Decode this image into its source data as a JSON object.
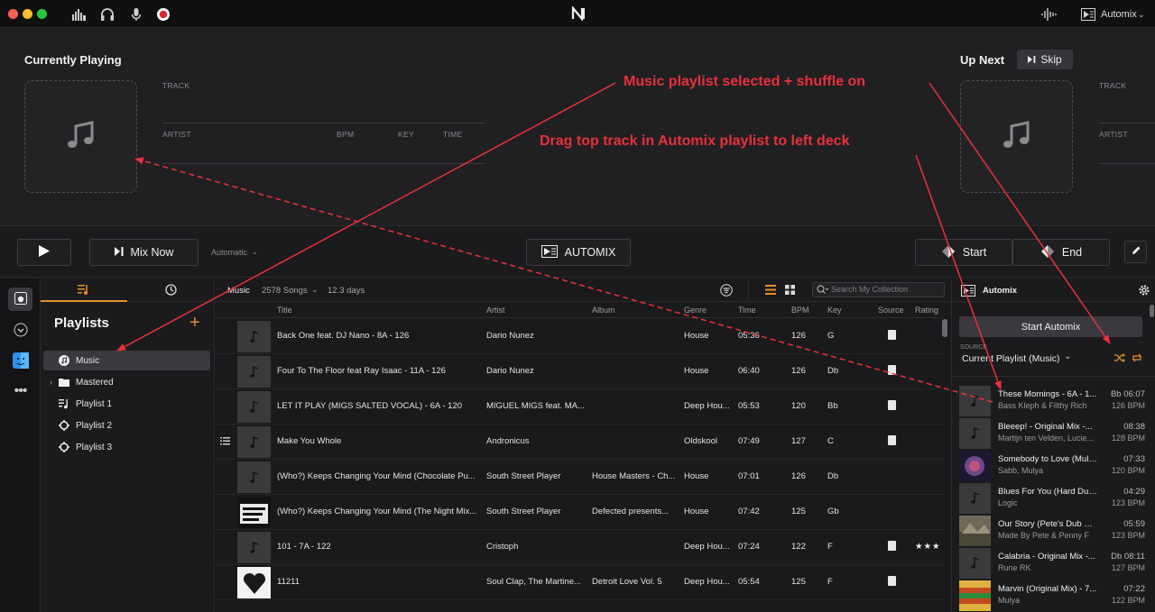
{
  "titlebar": {
    "automix_label": "Automix",
    "colors": {
      "close": "#fe5f57",
      "min": "#febc2e",
      "max": "#28c840"
    }
  },
  "left_deck": {
    "title": "Currently Playing",
    "track_label": "TRACK",
    "artist_label": "ARTIST",
    "bpm_label": "BPM",
    "key_label": "KEY",
    "time_label": "TIME"
  },
  "right_deck": {
    "title": "Up Next",
    "skip_label": "Skip",
    "track_label": "TRACK",
    "artist_label": "ARTIST"
  },
  "transport": {
    "mix_now_label": "Mix Now",
    "mode_label": "Automatic",
    "automix_label": "AUTOMIX",
    "start_label": "Start",
    "end_label": "End"
  },
  "playlists": {
    "title": "Playlists",
    "add_label": "+",
    "items": [
      {
        "label": "Music",
        "selected": true,
        "icon": "music-circle-icon"
      },
      {
        "label": "Mastered",
        "icon": "folder-icon"
      },
      {
        "label": "Playlist 1",
        "icon": "playlist-icon"
      },
      {
        "label": "Playlist 2",
        "icon": "smart-playlist-icon"
      },
      {
        "label": "Playlist 3",
        "icon": "smart-playlist-icon"
      }
    ]
  },
  "collection": {
    "source_label": "Music",
    "song_count": "2578 Songs",
    "duration": "12.3 days",
    "search_placeholder": "Search My Collection",
    "columns": [
      "Title",
      "Artist",
      "Album",
      "Genre",
      "Time",
      "BPM",
      "Key",
      "Source",
      "Rating"
    ],
    "rows": [
      {
        "title": "Back One feat. DJ Nano - 8A - 126",
        "artist": "Dario Nunez",
        "album": "",
        "genre": "House",
        "time": "05:36",
        "bpm": "126",
        "key": "G",
        "rating": ""
      },
      {
        "title": "Four To The Floor feat Ray Isaac - 11A - 126",
        "artist": "Dario Nunez",
        "album": "",
        "genre": "House",
        "time": "06:40",
        "bpm": "126",
        "key": "Db",
        "rating": ""
      },
      {
        "title": "LET IT PLAY (MIGS SALTED VOCAL) - 6A - 120",
        "artist": "MIGUEL MIGS feat. MA...",
        "album": "",
        "genre": "Deep Hou...",
        "time": "05:53",
        "bpm": "120",
        "key": "Bb",
        "rating": ""
      },
      {
        "title": "Make You Whole",
        "artist": "Andronicus",
        "album": "",
        "genre": "Oldskool",
        "time": "07:49",
        "bpm": "127",
        "key": "C",
        "rating": ""
      },
      {
        "title": "(Who?) Keeps Changing Your Mind (Chocolate Pu...",
        "artist": "South Street Player",
        "album": "House Masters - Ch...",
        "genre": "House",
        "time": "07:01",
        "bpm": "126",
        "key": "Db",
        "rating": ""
      },
      {
        "title": "(Who?) Keeps Changing Your Mind (The Night Mix...",
        "artist": "South Street Player",
        "album": "Defected presents...",
        "genre": "House",
        "time": "07:42",
        "bpm": "125",
        "key": "Gb",
        "rating": ""
      },
      {
        "title": "101 - 7A - 122",
        "artist": "Cristoph",
        "album": "",
        "genre": "Deep Hou...",
        "time": "07:24",
        "bpm": "122",
        "key": "F",
        "rating": "★★★"
      },
      {
        "title": "11211",
        "artist": "Soul Clap, The Martine...",
        "album": "Detroit Love Vol. 5",
        "genre": "Deep Hou...",
        "time": "05:54",
        "bpm": "125",
        "key": "F",
        "rating": ""
      }
    ]
  },
  "automix_panel": {
    "title": "Automix",
    "start_label": "Start Automix",
    "source_label": "SOURCE",
    "source_value": "Current Playlist (Music)",
    "queue": [
      {
        "title": "These Mornings - 6A - 1...",
        "artist": "Bass Kleph & Filthy Rich",
        "time": "Bb 06:07",
        "bpm": "126 BPM"
      },
      {
        "title": "Bleeep! - Original Mix -...",
        "artist": "Martijn ten Velden, Lucie...",
        "time": "08:38",
        "bpm": "128 BPM"
      },
      {
        "title": "Somebody to Love (Muly...",
        "artist": "Sabb, Mulya",
        "time": "07:33",
        "bpm": "120 BPM"
      },
      {
        "title": "Blues For You (Hard Dub...",
        "artist": "Logic",
        "time": "04:29",
        "bpm": "123 BPM"
      },
      {
        "title": "Our Story (Pete's Dub Mi...",
        "artist": "Made By Pete & Penny F",
        "time": "05:59",
        "bpm": "123 BPM"
      },
      {
        "title": "Calabria - Original Mix -...",
        "artist": "Rune RK",
        "time": "Db 08:11",
        "bpm": "127 BPM"
      },
      {
        "title": "Marvin (Original Mix) - 7...",
        "artist": "Mulya",
        "time": "07:22",
        "bpm": "122 BPM"
      }
    ]
  },
  "annotations": {
    "note1": "Music playlist selected + shuffle on",
    "note2": "Drag top track in Automix playlist to left deck"
  },
  "accent_color": "#e8902a",
  "annotation_color": "#e8303b"
}
